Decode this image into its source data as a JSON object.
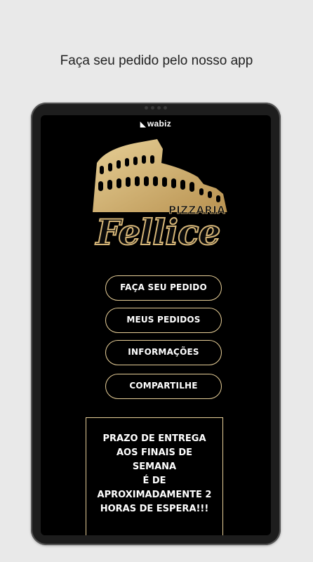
{
  "header": {
    "headline": "Faça seu pedido pelo nosso app"
  },
  "app": {
    "brand_mark": "◣",
    "brand_name": "wabiz",
    "logo": {
      "script": "Fellice",
      "top_word": "PIZZARIA"
    },
    "menu": [
      {
        "label": "FAÇA SEU PEDIDO"
      },
      {
        "label": "MEUS PEDIDOS"
      },
      {
        "label": "INFORMAÇÕES"
      },
      {
        "label": "COMPARTILHE"
      }
    ],
    "notice_lines": [
      "PRAZO DE ENTREGA",
      "AOS FINAIS DE SEMANA",
      "É DE",
      "APROXIMADAMENTE 2",
      "HORAS DE ESPERA!!!"
    ]
  },
  "colors": {
    "gold": "#d6b678",
    "button_border": "#e8cf98",
    "screen": "#000000",
    "bezel": "#1d1d1d"
  }
}
